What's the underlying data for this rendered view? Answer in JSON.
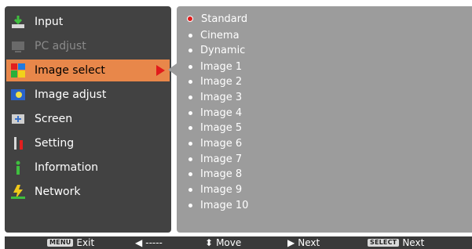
{
  "menu": {
    "items": [
      {
        "label": "Input",
        "icon": "input-icon",
        "state": "normal"
      },
      {
        "label": "PC adjust",
        "icon": "pc-adjust-icon",
        "state": "disabled"
      },
      {
        "label": "Image select",
        "icon": "image-select-icon",
        "state": "selected"
      },
      {
        "label": "Image adjust",
        "icon": "image-adjust-icon",
        "state": "normal"
      },
      {
        "label": "Screen",
        "icon": "screen-icon",
        "state": "normal"
      },
      {
        "label": "Setting",
        "icon": "setting-icon",
        "state": "normal"
      },
      {
        "label": "Information",
        "icon": "information-icon",
        "state": "normal"
      },
      {
        "label": "Network",
        "icon": "network-icon",
        "state": "normal"
      }
    ]
  },
  "options": {
    "items": [
      {
        "label": "Standard",
        "active": true
      },
      {
        "label": "Cinema",
        "active": false
      },
      {
        "label": "Dynamic",
        "active": false
      },
      {
        "label": "Image 1",
        "active": false
      },
      {
        "label": "Image 2",
        "active": false
      },
      {
        "label": "Image 3",
        "active": false
      },
      {
        "label": "Image 4",
        "active": false
      },
      {
        "label": "Image 5",
        "active": false
      },
      {
        "label": "Image 6",
        "active": false
      },
      {
        "label": "Image 7",
        "active": false
      },
      {
        "label": "Image 8",
        "active": false
      },
      {
        "label": "Image 9",
        "active": false
      },
      {
        "label": "Image 10",
        "active": false
      }
    ]
  },
  "footer": {
    "exit_key": "MENU",
    "exit_label": "Exit",
    "back_label": "-----",
    "move_label": "Move",
    "next_label": "Next",
    "select_key": "SELECT",
    "select_label": "Next"
  },
  "colors": {
    "selected_bg": "#e8874a",
    "arrow_red": "#e11b1b",
    "panel_bg": "#9c9c9c",
    "sidebar_bg": "#424242"
  }
}
